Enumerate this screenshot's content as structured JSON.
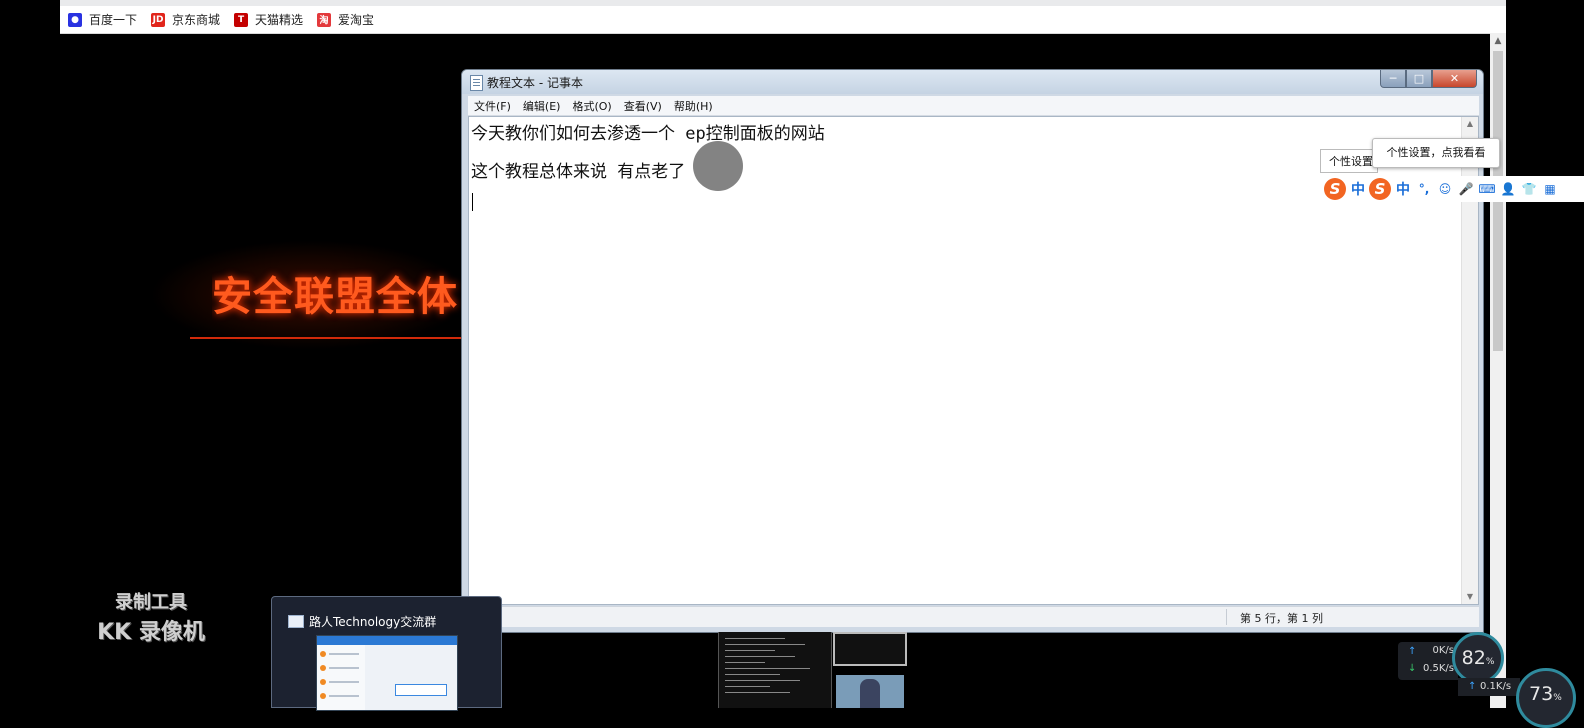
{
  "browser": {
    "bookmarks": [
      {
        "label": "百度一下",
        "icon": "baidu-paw-icon",
        "glyph": "🐾"
      },
      {
        "label": "京东商城",
        "icon": "jd-icon",
        "glyph": "JD"
      },
      {
        "label": "天猫精选",
        "icon": "tmall-icon",
        "glyph": "T"
      },
      {
        "label": "爱淘宝",
        "icon": "taobao-icon",
        "glyph": "淘"
      }
    ]
  },
  "background": {
    "banner_text": "安全联盟全体",
    "recorder_line1": "录制工具",
    "recorder_line2": "KK 录像机"
  },
  "notepad": {
    "title": "教程文本 - 记事本",
    "menu": [
      "文件(F)",
      "编辑(E)",
      "格式(O)",
      "查看(V)",
      "帮助(H)"
    ],
    "lines": [
      "今天教你们如何去渗透一个 ep控制面板的网站",
      "这个教程总体来说 有点老了"
    ],
    "status_position": "第 5 行，第 1 列",
    "window_controls": {
      "minimize": "─",
      "maximize": "□",
      "close": "✕"
    }
  },
  "ime": {
    "tooltip_small": "个性设置",
    "tooltip_large": "个性设置，点我看看",
    "mode_label": "中",
    "brand_color": "#f26522",
    "accent_color": "#1a6ed8"
  },
  "taskbar_preview": {
    "title": "路人Technology交流群"
  },
  "widget": {
    "upload_speed": "0K/s",
    "download_speed": "0.5K/s",
    "cpu_percent": "82",
    "upload_speed_2": "0.1K/s",
    "cpu_percent_2": "73",
    "percent_sign": "%"
  }
}
